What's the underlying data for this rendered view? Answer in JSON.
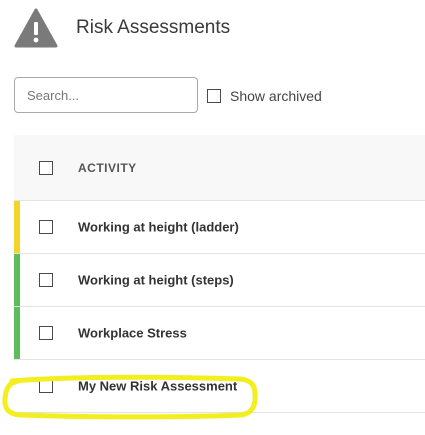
{
  "header": {
    "title": "Risk Assessments",
    "icon": "warning-triangle-icon"
  },
  "toolbar": {
    "search_placeholder": "Search...",
    "search_value": "",
    "show_archived_label": "Show archived",
    "show_archived_checked": false
  },
  "table": {
    "columns": [
      "ACTIVITY"
    ],
    "rows": [
      {
        "activity": "Working at height (ladder)",
        "status_color": "#f5d327"
      },
      {
        "activity": "Working at height (steps)",
        "status_color": "#5cbd5c"
      },
      {
        "activity": "Workplace Stress",
        "status_color": "#5cbd5c"
      },
      {
        "activity": "My New Risk Assessment",
        "status_color": ""
      }
    ]
  },
  "annotation": {
    "highlight_color": "#f3ee1f",
    "highlighted_row": "My New Risk Assessment"
  }
}
